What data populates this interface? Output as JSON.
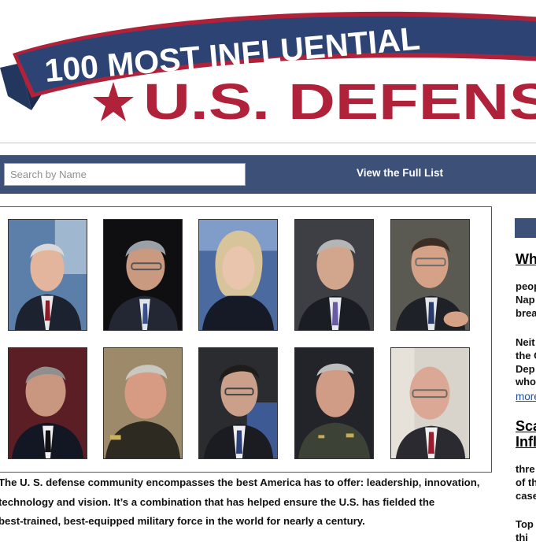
{
  "banner": {
    "line1": "100 MOST INFLUENTIAL",
    "line2": "U.S. DEFENS",
    "colors": {
      "navy": "#2d4373",
      "red": "#b0223a",
      "white": "#ffffff"
    }
  },
  "nav": {
    "search_placeholder": "Search by Name",
    "full_list_label": "View the Full List"
  },
  "photos": [
    {
      "icon": "portrait"
    },
    {
      "icon": "portrait"
    },
    {
      "icon": "portrait"
    },
    {
      "icon": "portrait"
    },
    {
      "icon": "portrait"
    },
    {
      "icon": "portrait"
    },
    {
      "icon": "portrait"
    },
    {
      "icon": "portrait"
    },
    {
      "icon": "portrait"
    },
    {
      "icon": "portrait"
    }
  ],
  "intro": {
    "line1": "The U. S. defense community encompasses the best America has to offer: leadership, innovation,",
    "line2": "technology and vision. It’s a combination that has helped ensure the U.S. has fielded the",
    "line3": "best-trained, best-equipped military force in the world for nearly a century."
  },
  "sidebar": {
    "heading1": "Wh",
    "p1": [
      "peop",
      "Nap",
      "brea"
    ],
    "p2": [
      "Neit",
      "the C",
      "Dep",
      "who"
    ],
    "more_link": "more",
    "heading2_line1": "Sca",
    "heading2_line2": "Infl",
    "p3": [
      "thre",
      "of th",
      "case"
    ],
    "p4": [
      "Top",
      "thi"
    ]
  }
}
